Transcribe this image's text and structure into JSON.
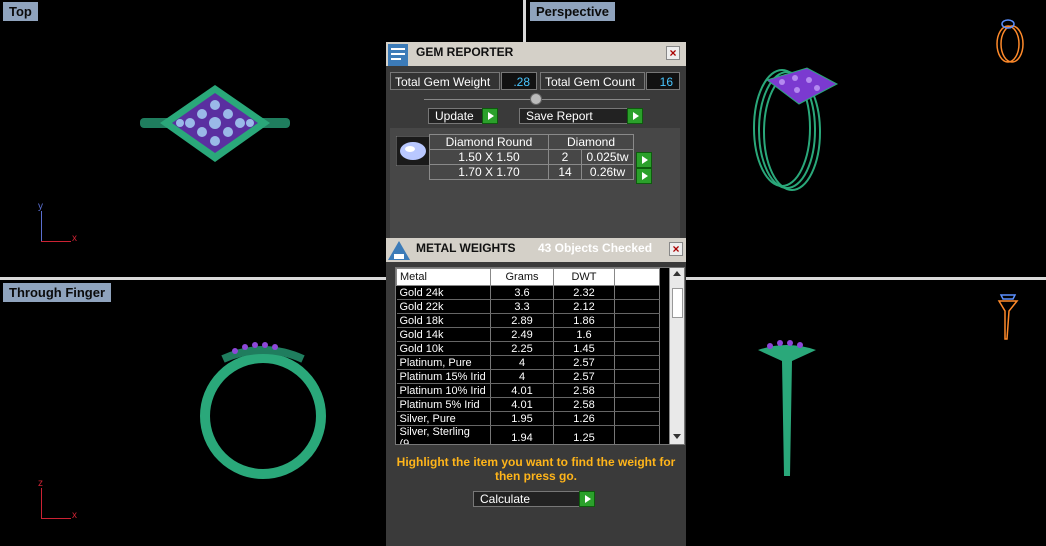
{
  "viewports": {
    "top": "Top",
    "perspective": "Perspective",
    "through_finger": "Through Finger",
    "axis_top": {
      "y": "y",
      "x": "x"
    },
    "axis_front": {
      "z": "z",
      "x": "x"
    }
  },
  "gem_reporter": {
    "title": "GEM REPORTER",
    "total_weight_label": "Total Gem Weight",
    "total_weight_value": ".28",
    "total_count_label": "Total Gem Count",
    "total_count_value": "16",
    "update_label": "Update",
    "save_label": "Save Report",
    "table_header": {
      "shape": "Diamond Round",
      "type": "Diamond"
    },
    "rows": [
      {
        "size": "1.50 X 1.50",
        "count": "2",
        "weight": "0.025tw"
      },
      {
        "size": "1.70 X 1.70",
        "count": "14",
        "weight": "0.26tw"
      }
    ]
  },
  "metal_weights": {
    "title": "METAL WEIGHTS",
    "status": "43 Objects Checked",
    "columns": [
      "Metal",
      "Grams",
      "DWT"
    ],
    "rows": [
      [
        "Gold 24k",
        "3.6",
        "2.32"
      ],
      [
        "Gold 22k",
        "3.3",
        "2.12"
      ],
      [
        "Gold 18k",
        "2.89",
        "1.86"
      ],
      [
        "Gold 14k",
        "2.49",
        "1.6"
      ],
      [
        "Gold 10k",
        "2.25",
        "1.45"
      ],
      [
        "Platinum, Pure",
        "4",
        "2.57"
      ],
      [
        "Platinum 15% Irid",
        "4",
        "2.57"
      ],
      [
        "Platinum 10% Irid",
        "4.01",
        "2.58"
      ],
      [
        "Platinum 5% Irid",
        "4.01",
        "2.58"
      ],
      [
        "Silver, Pure",
        "1.95",
        "1.26"
      ],
      [
        "Silver, Sterling (9...",
        "1.94",
        "1.25"
      ]
    ],
    "instruction": "Highlight the item you want to find the weight for then press go.",
    "calculate_label": "Calculate"
  },
  "colors": {
    "ring": "#2aa87a",
    "gems": "#8d47d8",
    "viewport_label_bg": "#8fa3bd"
  }
}
